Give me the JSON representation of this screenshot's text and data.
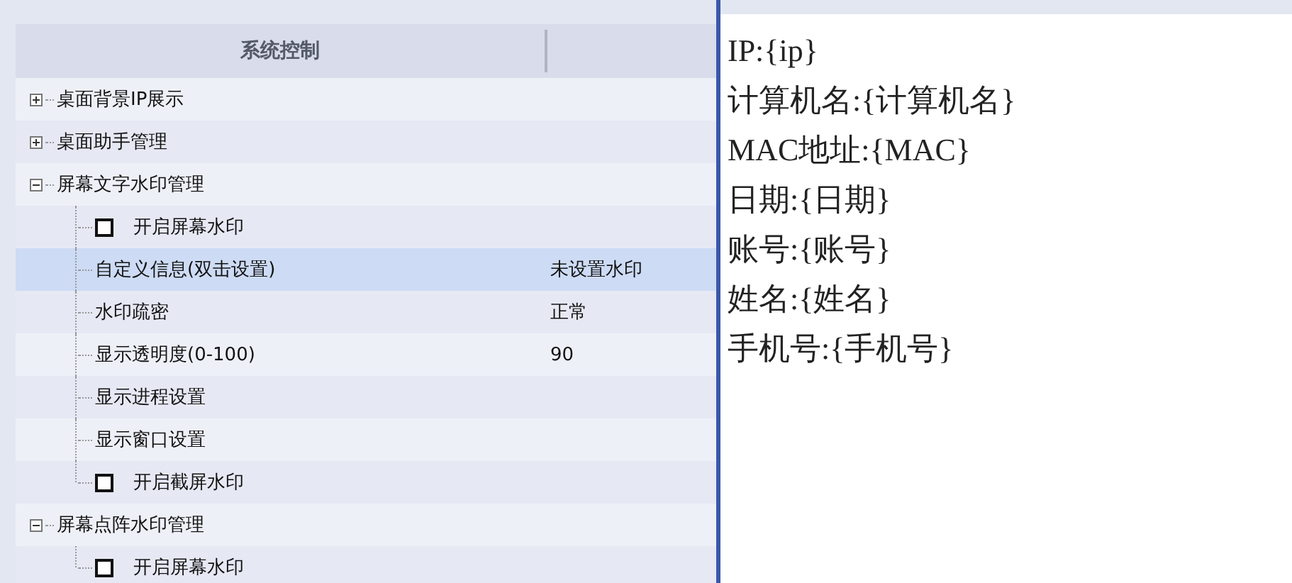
{
  "tree": {
    "header": "系统控制",
    "items": [
      {
        "kind": "group",
        "label": "桌面背景IP展示",
        "expanded": false,
        "selected": false
      },
      {
        "kind": "group",
        "label": "桌面助手管理",
        "expanded": false,
        "selected": false
      },
      {
        "kind": "group",
        "label": "屏幕文字水印管理",
        "expanded": true,
        "selected": false,
        "children": [
          {
            "kind": "checkbox",
            "label": "开启屏幕水印",
            "checked": false,
            "selected": false
          },
          {
            "kind": "setting",
            "label": "自定义信息(双击设置)",
            "value": "未设置水印",
            "selected": true
          },
          {
            "kind": "setting",
            "label": "水印疏密",
            "value": "正常",
            "selected": false
          },
          {
            "kind": "setting",
            "label": "显示透明度(0-100)",
            "value": "90",
            "selected": false
          },
          {
            "kind": "setting",
            "label": "显示进程设置",
            "selected": false
          },
          {
            "kind": "setting",
            "label": "显示窗口设置",
            "selected": false
          },
          {
            "kind": "checkbox",
            "label": "开启截屏水印",
            "checked": false,
            "selected": false
          }
        ]
      },
      {
        "kind": "group",
        "label": "屏幕点阵水印管理",
        "expanded": true,
        "selected": false,
        "children": [
          {
            "kind": "checkbox",
            "label": "开启屏幕水印",
            "checked": false,
            "selected": false
          }
        ]
      }
    ]
  },
  "editor": {
    "lines": [
      "IP:{ip}",
      "计算机名:{计算机名}",
      "MAC地址:{MAC}",
      "日期:{日期}",
      "账号:{账号}",
      "姓名:{姓名}",
      "手机号:{手机号}"
    ]
  }
}
